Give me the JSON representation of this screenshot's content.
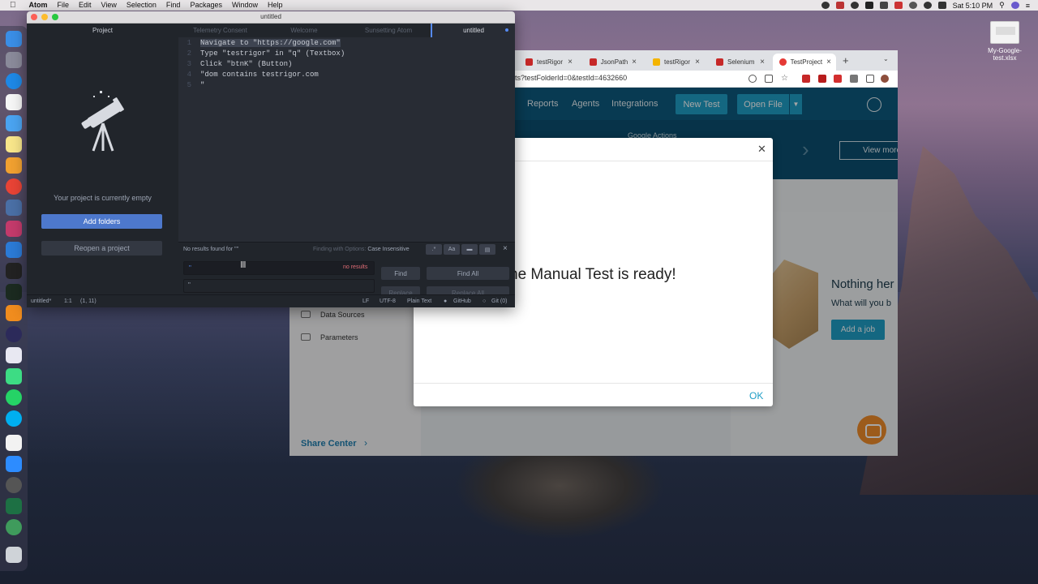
{
  "menubar": {
    "apple": "",
    "app": "Atom",
    "items": [
      "File",
      "Edit",
      "View",
      "Selection",
      "Find",
      "Packages",
      "Window",
      "Help"
    ],
    "clock": "Sat 5:10 PM"
  },
  "desktop_file": {
    "name": "My-Google-test.xlsx"
  },
  "atom": {
    "window_title": "untitled",
    "tabs": [
      "Project",
      "Telemetry Consent",
      "Welcome",
      "Sunsetting Atom",
      "untitled"
    ],
    "empty_message": "Your project is currently empty",
    "add_folders": "Add folders",
    "reopen": "Reopen a project",
    "lines": [
      {
        "n": "1",
        "text": "Navigate to \"https://google.com\""
      },
      {
        "n": "2",
        "text": "Type \"testrigor\" in \"q\" (Textbox)"
      },
      {
        "n": "3",
        "text": "Click \"btnK\" (Button)"
      },
      {
        "n": "4",
        "text": "\"dom contains testrigor.com"
      },
      {
        "n": "5",
        "text": "\""
      }
    ],
    "find": {
      "status": "No results found for '\"'",
      "options_label": "Finding with Options:",
      "options_value": "Case Insensitive",
      "opt_regex": ".*",
      "opt_case": "Aa",
      "query": "\"",
      "no_results": "no results",
      "replace_value": "\"",
      "find_btn": "Find",
      "find_all_btn": "Find All",
      "replace_btn": "Replace",
      "replace_all_btn": "Replace All"
    },
    "status": {
      "file": "untitled*",
      "pos": "1:1",
      "sel": "(1, 11)",
      "eol": "LF",
      "enc": "UTF-8",
      "grammar": "Plain Text",
      "github": "GitHub",
      "git": "Git (0)"
    }
  },
  "chrome": {
    "tabs": [
      "testRigor",
      "JsonPath",
      "testRigor",
      "Selenium",
      "TestProject"
    ],
    "url": "ts?testFolderId=0&testId=4632660",
    "nav": [
      "Reports",
      "Agents",
      "Integrations"
    ],
    "new_test": "New Test",
    "open_file": "Open File",
    "banner_label": "Google Actions",
    "view_more": "View more",
    "side_items": [
      "Data Sources",
      "Parameters"
    ],
    "share_center": "Share Center",
    "nothing_here": "Nothing her",
    "what_will": "What will you b",
    "add_job": "Add a job"
  },
  "modal": {
    "message": "he Manual Test is ready!",
    "ok": "OK"
  },
  "colors": {
    "atom_accent": "#568af2",
    "testproject_header": "#0d5a7e",
    "testproject_button": "#1f9ec6"
  }
}
